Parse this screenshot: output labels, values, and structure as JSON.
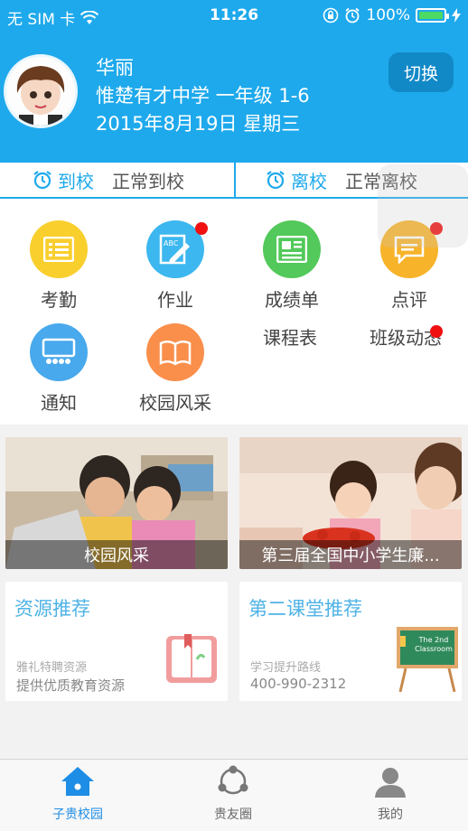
{
  "status_bar": {
    "carrier": "无 SIM 卡",
    "time": "11:26",
    "battery_pct": "100%",
    "battery_level": 1.0
  },
  "profile": {
    "name": "华丽",
    "school_class": "惟楚有才中学 一年级 1-6",
    "date": "2015年8月19日 星期三",
    "switch_label": "切换"
  },
  "attendance": {
    "arrive_label": "到校",
    "arrive_value": "正常到校",
    "leave_label": "离校",
    "leave_value": "正常离校"
  },
  "grid": {
    "items": [
      {
        "label": "考勤",
        "color": "#f9cf2e",
        "icon": "list-icon"
      },
      {
        "label": "作业",
        "color": "#3cb7ef",
        "icon": "homework-icon"
      },
      {
        "label": "成绩单",
        "color": "#52c95a",
        "icon": "newspaper-icon"
      },
      {
        "label": "点评",
        "color": "#f7b32a",
        "icon": "comment-icon"
      },
      {
        "label": "通知",
        "color": "#48a9ec",
        "icon": "notice-icon"
      },
      {
        "label": "校园风采",
        "color": "#f98f4b",
        "icon": "book-icon"
      }
    ],
    "text_items": [
      "课程表",
      "班级动态"
    ]
  },
  "image_cards": [
    {
      "caption": "校园风采"
    },
    {
      "caption": "第三届全国中小学生廉..."
    }
  ],
  "rec_cards": [
    {
      "title": "资源推荐",
      "sub1": "雅礼特聘资源",
      "sub2": "提供优质教育资源"
    },
    {
      "title": "第二课堂推荐",
      "sub1": "学习提升路线",
      "sub2": "400-990-2312",
      "board_text1": "The 2nd",
      "board_text2": "Classroom"
    }
  ],
  "tabbar": {
    "tabs": [
      {
        "label": "子贵校园"
      },
      {
        "label": "贵友圈"
      },
      {
        "label": "我的"
      }
    ],
    "active_color": "#1e8de6"
  }
}
